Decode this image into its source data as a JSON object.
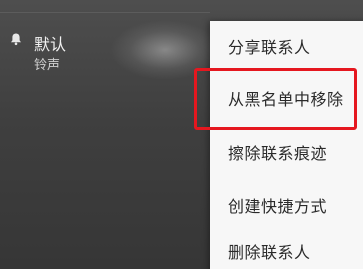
{
  "setting": {
    "title": "默认",
    "subtitle": "铃声",
    "icon": "bell-icon"
  },
  "context_menu": {
    "items": [
      {
        "label": "分享联系人"
      },
      {
        "label": "从黑名单中移除"
      },
      {
        "label": "擦除联系痕迹"
      },
      {
        "label": "创建快捷方式"
      },
      {
        "label": "删除联系人"
      }
    ],
    "highlighted_index": 1
  },
  "colors": {
    "highlight": "#e5171f",
    "menu_background": "#f7f7f7",
    "screen_background": "#444444"
  }
}
